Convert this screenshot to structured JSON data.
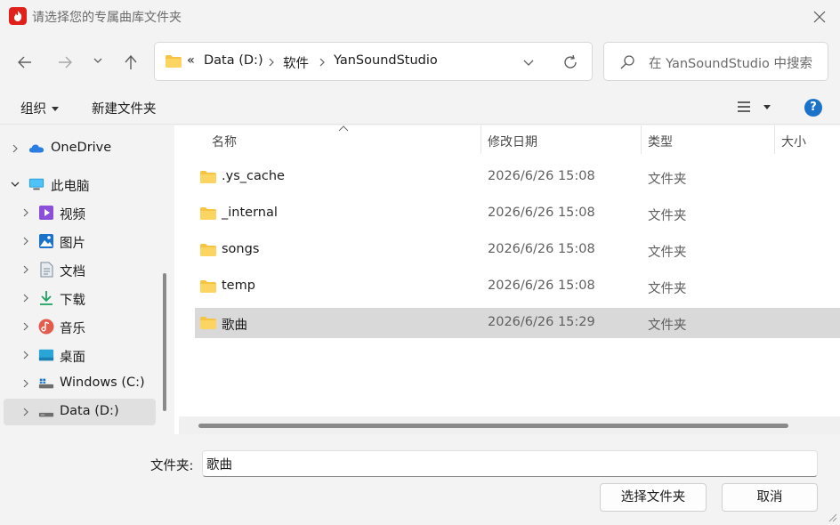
{
  "window": {
    "title": "请选择您的专属曲库文件夹"
  },
  "address": {
    "overflow": "«",
    "segments": [
      "Data (D:)",
      "软件",
      "YanSoundStudio"
    ]
  },
  "search": {
    "placeholder": "在 YanSoundStudio 中搜索"
  },
  "toolbar": {
    "organize_label": "组织",
    "new_folder_label": "新建文件夹",
    "help_label": "?"
  },
  "sidebar": {
    "items": [
      {
        "label": "OneDrive",
        "icon": "onedrive-icon"
      },
      {
        "label": "此电脑",
        "icon": "computer-icon"
      },
      {
        "label": "视频",
        "icon": "videos-icon"
      },
      {
        "label": "图片",
        "icon": "pictures-icon"
      },
      {
        "label": "文档",
        "icon": "documents-icon"
      },
      {
        "label": "下载",
        "icon": "downloads-icon"
      },
      {
        "label": "音乐",
        "icon": "music-icon"
      },
      {
        "label": "桌面",
        "icon": "desktop-icon"
      },
      {
        "label": "Windows (C:)",
        "icon": "drive-icon"
      },
      {
        "label": "Data (D:)",
        "icon": "drive-icon"
      }
    ]
  },
  "columns": {
    "name": "名称",
    "modified": "修改日期",
    "type": "类型",
    "size": "大小"
  },
  "files": [
    {
      "name": ".ys_cache",
      "modified": "2026/6/26 15:08",
      "type": "文件夹"
    },
    {
      "name": "_internal",
      "modified": "2026/6/26 15:08",
      "type": "文件夹"
    },
    {
      "name": "songs",
      "modified": "2026/6/26 15:08",
      "type": "文件夹"
    },
    {
      "name": "temp",
      "modified": "2026/6/26 15:08",
      "type": "文件夹"
    },
    {
      "name": "歌曲",
      "modified": "2026/6/26 15:29",
      "type": "文件夹"
    }
  ],
  "footer": {
    "folder_label": "文件夹:",
    "folder_value": "歌曲",
    "select_label": "选择文件夹",
    "cancel_label": "取消"
  },
  "colors": {
    "accent": "#1a73c9",
    "folder": "#f6c342",
    "selection": "#d9d9d9"
  }
}
